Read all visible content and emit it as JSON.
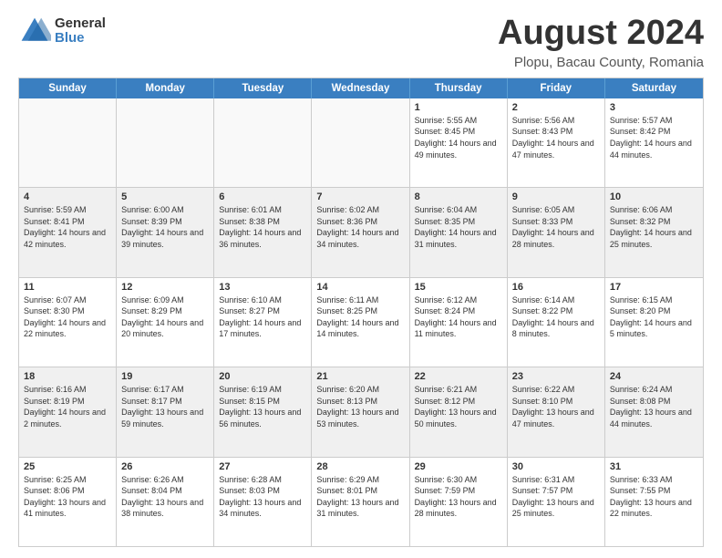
{
  "logo": {
    "general": "General",
    "blue": "Blue"
  },
  "title": "August 2024",
  "subtitle": "Plopu, Bacau County, Romania",
  "header_days": [
    "Sunday",
    "Monday",
    "Tuesday",
    "Wednesday",
    "Thursday",
    "Friday",
    "Saturday"
  ],
  "weeks": [
    [
      {
        "day": "",
        "info": ""
      },
      {
        "day": "",
        "info": ""
      },
      {
        "day": "",
        "info": ""
      },
      {
        "day": "",
        "info": ""
      },
      {
        "day": "1",
        "info": "Sunrise: 5:55 AM\nSunset: 8:45 PM\nDaylight: 14 hours and 49 minutes."
      },
      {
        "day": "2",
        "info": "Sunrise: 5:56 AM\nSunset: 8:43 PM\nDaylight: 14 hours and 47 minutes."
      },
      {
        "day": "3",
        "info": "Sunrise: 5:57 AM\nSunset: 8:42 PM\nDaylight: 14 hours and 44 minutes."
      }
    ],
    [
      {
        "day": "4",
        "info": "Sunrise: 5:59 AM\nSunset: 8:41 PM\nDaylight: 14 hours and 42 minutes."
      },
      {
        "day": "5",
        "info": "Sunrise: 6:00 AM\nSunset: 8:39 PM\nDaylight: 14 hours and 39 minutes."
      },
      {
        "day": "6",
        "info": "Sunrise: 6:01 AM\nSunset: 8:38 PM\nDaylight: 14 hours and 36 minutes."
      },
      {
        "day": "7",
        "info": "Sunrise: 6:02 AM\nSunset: 8:36 PM\nDaylight: 14 hours and 34 minutes."
      },
      {
        "day": "8",
        "info": "Sunrise: 6:04 AM\nSunset: 8:35 PM\nDaylight: 14 hours and 31 minutes."
      },
      {
        "day": "9",
        "info": "Sunrise: 6:05 AM\nSunset: 8:33 PM\nDaylight: 14 hours and 28 minutes."
      },
      {
        "day": "10",
        "info": "Sunrise: 6:06 AM\nSunset: 8:32 PM\nDaylight: 14 hours and 25 minutes."
      }
    ],
    [
      {
        "day": "11",
        "info": "Sunrise: 6:07 AM\nSunset: 8:30 PM\nDaylight: 14 hours and 22 minutes."
      },
      {
        "day": "12",
        "info": "Sunrise: 6:09 AM\nSunset: 8:29 PM\nDaylight: 14 hours and 20 minutes."
      },
      {
        "day": "13",
        "info": "Sunrise: 6:10 AM\nSunset: 8:27 PM\nDaylight: 14 hours and 17 minutes."
      },
      {
        "day": "14",
        "info": "Sunrise: 6:11 AM\nSunset: 8:25 PM\nDaylight: 14 hours and 14 minutes."
      },
      {
        "day": "15",
        "info": "Sunrise: 6:12 AM\nSunset: 8:24 PM\nDaylight: 14 hours and 11 minutes."
      },
      {
        "day": "16",
        "info": "Sunrise: 6:14 AM\nSunset: 8:22 PM\nDaylight: 14 hours and 8 minutes."
      },
      {
        "day": "17",
        "info": "Sunrise: 6:15 AM\nSunset: 8:20 PM\nDaylight: 14 hours and 5 minutes."
      }
    ],
    [
      {
        "day": "18",
        "info": "Sunrise: 6:16 AM\nSunset: 8:19 PM\nDaylight: 14 hours and 2 minutes."
      },
      {
        "day": "19",
        "info": "Sunrise: 6:17 AM\nSunset: 8:17 PM\nDaylight: 13 hours and 59 minutes."
      },
      {
        "day": "20",
        "info": "Sunrise: 6:19 AM\nSunset: 8:15 PM\nDaylight: 13 hours and 56 minutes."
      },
      {
        "day": "21",
        "info": "Sunrise: 6:20 AM\nSunset: 8:13 PM\nDaylight: 13 hours and 53 minutes."
      },
      {
        "day": "22",
        "info": "Sunrise: 6:21 AM\nSunset: 8:12 PM\nDaylight: 13 hours and 50 minutes."
      },
      {
        "day": "23",
        "info": "Sunrise: 6:22 AM\nSunset: 8:10 PM\nDaylight: 13 hours and 47 minutes."
      },
      {
        "day": "24",
        "info": "Sunrise: 6:24 AM\nSunset: 8:08 PM\nDaylight: 13 hours and 44 minutes."
      }
    ],
    [
      {
        "day": "25",
        "info": "Sunrise: 6:25 AM\nSunset: 8:06 PM\nDaylight: 13 hours and 41 minutes."
      },
      {
        "day": "26",
        "info": "Sunrise: 6:26 AM\nSunset: 8:04 PM\nDaylight: 13 hours and 38 minutes."
      },
      {
        "day": "27",
        "info": "Sunrise: 6:28 AM\nSunset: 8:03 PM\nDaylight: 13 hours and 34 minutes."
      },
      {
        "day": "28",
        "info": "Sunrise: 6:29 AM\nSunset: 8:01 PM\nDaylight: 13 hours and 31 minutes."
      },
      {
        "day": "29",
        "info": "Sunrise: 6:30 AM\nSunset: 7:59 PM\nDaylight: 13 hours and 28 minutes."
      },
      {
        "day": "30",
        "info": "Sunrise: 6:31 AM\nSunset: 7:57 PM\nDaylight: 13 hours and 25 minutes."
      },
      {
        "day": "31",
        "info": "Sunrise: 6:33 AM\nSunset: 7:55 PM\nDaylight: 13 hours and 22 minutes."
      }
    ]
  ]
}
